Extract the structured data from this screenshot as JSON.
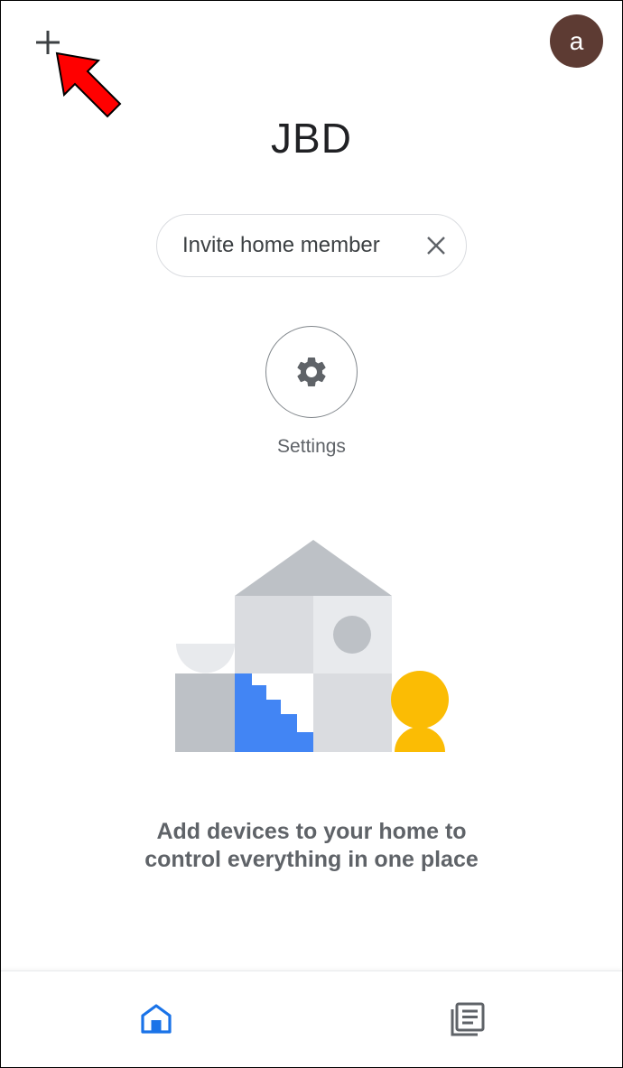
{
  "header": {
    "add_icon": "plus-icon",
    "avatar_letter": "a",
    "avatar_color": "#5d3b33",
    "pointer_color": "#ff0000"
  },
  "home": {
    "title": "JBD"
  },
  "invite_chip": {
    "label": "Invite home member",
    "close_icon": "close-icon"
  },
  "settings": {
    "icon": "gear-icon",
    "label": "Settings"
  },
  "illustration": {
    "icon": "home-blocks-illustration",
    "colors": {
      "gray_light": "#e8eaed",
      "gray_mid": "#dadce0",
      "gray_dark": "#bdc1c6",
      "blue": "#4285f4",
      "yellow": "#fbbc04"
    }
  },
  "empty_state": {
    "message": "Add devices to your home to control everything in one place"
  },
  "bottom_nav": {
    "items": [
      {
        "icon": "home-icon",
        "active": true,
        "color": "#1a73e8"
      },
      {
        "icon": "feed-icon",
        "active": false,
        "color": "#5f6368"
      }
    ]
  }
}
